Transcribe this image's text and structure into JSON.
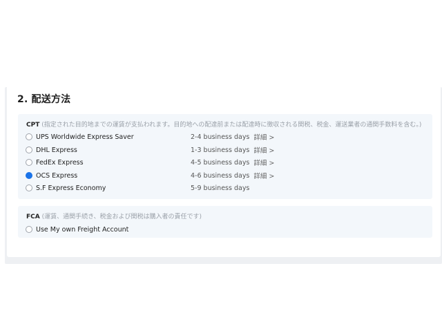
{
  "section": {
    "title": "2. 配送方法"
  },
  "cpt": {
    "code": "CPT",
    "note": "(指定された目的地までの運賃が支払われます。目的地への配達前または配達時に徴収される関税、税金、運送業者の通関手数料を含む。)",
    "options": [
      {
        "name": "UPS Worldwide Express Saver",
        "days": "2-4 business days",
        "detail": "詳細 >",
        "selected": false
      },
      {
        "name": "DHL Express",
        "days": "1-3 business days",
        "detail": "詳細 >",
        "selected": false
      },
      {
        "name": "FedEx Express",
        "days": "4-5 business days",
        "detail": "詳細 >",
        "selected": false
      },
      {
        "name": "OCS Express",
        "days": "4-6 business days",
        "detail": "詳細 >",
        "selected": true
      },
      {
        "name": "S.F Express Economy",
        "days": "5-9 business days",
        "detail": "",
        "selected": false
      }
    ]
  },
  "fca": {
    "code": "FCA",
    "note": "(運賃、通関手続き、税金および関税は購入者の責任です)",
    "options": [
      {
        "name": "Use My own Freight Account",
        "selected": false
      }
    ]
  },
  "colors": {
    "accent": "#1a73e8",
    "panel": "#f3f7fb"
  }
}
